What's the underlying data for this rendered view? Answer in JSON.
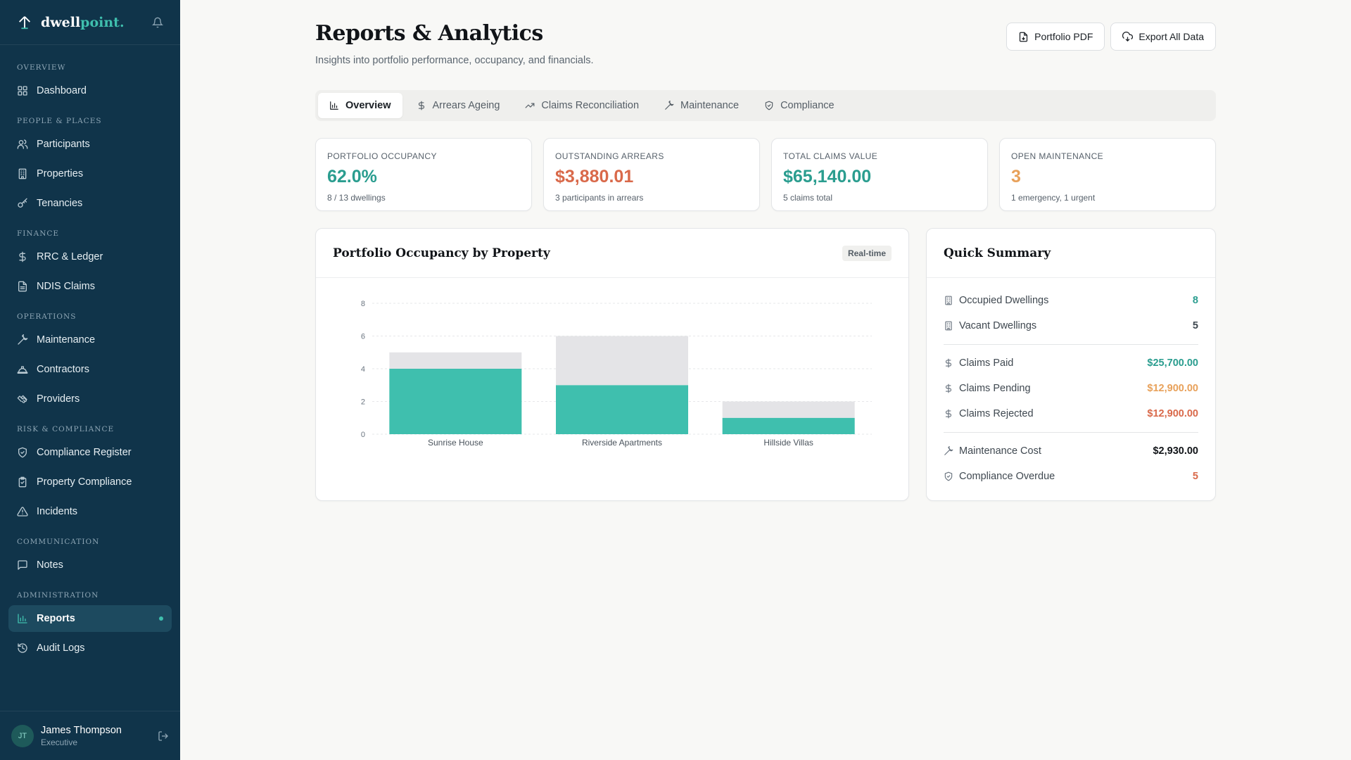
{
  "brand": {
    "name_main": "dwell",
    "name_accent": "point."
  },
  "sidebar": {
    "sections": [
      {
        "title": "Overview",
        "items": [
          {
            "label": "Dashboard",
            "icon": "grid-icon"
          }
        ]
      },
      {
        "title": "People & Places",
        "items": [
          {
            "label": "Participants",
            "icon": "users-icon"
          },
          {
            "label": "Properties",
            "icon": "building-icon"
          },
          {
            "label": "Tenancies",
            "icon": "key-icon"
          }
        ]
      },
      {
        "title": "Finance",
        "items": [
          {
            "label": "RRC & Ledger",
            "icon": "dollar-icon"
          },
          {
            "label": "NDIS Claims",
            "icon": "file-icon"
          }
        ]
      },
      {
        "title": "Operations",
        "items": [
          {
            "label": "Maintenance",
            "icon": "wrench-icon"
          },
          {
            "label": "Contractors",
            "icon": "hardhat-icon"
          },
          {
            "label": "Providers",
            "icon": "handshake-icon"
          }
        ]
      },
      {
        "title": "Risk & Compliance",
        "items": [
          {
            "label": "Compliance Register",
            "icon": "shield-icon"
          },
          {
            "label": "Property Compliance",
            "icon": "clipboard-icon"
          },
          {
            "label": "Incidents",
            "icon": "alert-icon"
          }
        ]
      },
      {
        "title": "Communication",
        "items": [
          {
            "label": "Notes",
            "icon": "message-icon"
          }
        ]
      },
      {
        "title": "Administration",
        "items": [
          {
            "label": "Reports",
            "icon": "bar-chart-icon",
            "active": true
          },
          {
            "label": "Audit Logs",
            "icon": "history-icon"
          }
        ]
      }
    ]
  },
  "user": {
    "initials": "JT",
    "name": "James Thompson",
    "role": "Executive"
  },
  "header": {
    "title": "Reports & Analytics",
    "subtitle": "Insights into portfolio performance, occupancy, and financials.",
    "btn_pdf": "Portfolio PDF",
    "btn_export": "Export All Data"
  },
  "tabs": [
    {
      "label": "Overview",
      "active": true
    },
    {
      "label": "Arrears Ageing"
    },
    {
      "label": "Claims Reconciliation"
    },
    {
      "label": "Maintenance"
    },
    {
      "label": "Compliance"
    }
  ],
  "stats": [
    {
      "label": "Portfolio Occupancy",
      "value": "62.0%",
      "sub": "8 / 13 dwellings",
      "color": "#2a9d8f"
    },
    {
      "label": "Outstanding Arrears",
      "value": "$3,880.01",
      "sub": "3 participants in arrears",
      "color": "#d9694a"
    },
    {
      "label": "Total Claims Value",
      "value": "$65,140.00",
      "sub": "5 claims total",
      "color": "#2a9d8f"
    },
    {
      "label": "Open Maintenance",
      "value": "3",
      "sub": "1 emergency, 1 urgent",
      "color": "#e8a15a"
    }
  ],
  "chart_card": {
    "title": "Portfolio Occupancy by Property",
    "badge": "Real-time"
  },
  "chart_data": {
    "type": "bar",
    "stacked": true,
    "categories": [
      "Sunrise House",
      "Riverside Apartments",
      "Hillside Villas"
    ],
    "series": [
      {
        "values": [
          4,
          3,
          1
        ],
        "color": "#3fbfae"
      },
      {
        "values": [
          1,
          3,
          1
        ],
        "color": "#e4e4e7"
      }
    ],
    "ylim": [
      0,
      8
    ],
    "yticks": [
      "0",
      "2",
      "4",
      "6",
      "8"
    ],
    "grid": true
  },
  "summary": {
    "title": "Quick Summary",
    "groups": [
      [
        {
          "label": "Occupied Dwellings",
          "value": "8",
          "color": "#2a9d8f",
          "icon": "building-icon"
        },
        {
          "label": "Vacant Dwellings",
          "value": "5",
          "color": "#3f4850",
          "icon": "building-icon"
        }
      ],
      [
        {
          "label": "Claims Paid",
          "value": "$25,700.00",
          "color": "#2a9d8f",
          "icon": "dollar-icon"
        },
        {
          "label": "Claims Pending",
          "value": "$12,900.00",
          "color": "#e8a15a",
          "icon": "dollar-icon"
        },
        {
          "label": "Claims Rejected",
          "value": "$12,900.00",
          "color": "#d9694a",
          "icon": "dollar-icon"
        }
      ],
      [
        {
          "label": "Maintenance Cost",
          "value": "$2,930.00",
          "color": "#111418",
          "icon": "wrench-icon"
        },
        {
          "label": "Compliance Overdue",
          "value": "5",
          "color": "#d9694a",
          "icon": "shield-icon"
        }
      ]
    ]
  }
}
